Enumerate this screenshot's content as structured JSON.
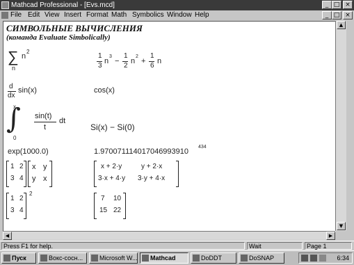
{
  "window": {
    "title": "Mathcad Professional - [Evs.mcd]"
  },
  "menu": {
    "items": [
      "File",
      "Edit",
      "View",
      "Insert",
      "Format",
      "Math",
      "Symbolics",
      "Window",
      "Help"
    ]
  },
  "document": {
    "heading1": "СИМВОЛЬНЫЕ  ВЫЧИСЛЕНИЯ",
    "heading2": "(команда Evaluate Simbolically)",
    "sum": {
      "symbol": "∑",
      "term": "n",
      "exp": "2",
      "index": "n",
      "r1": "1",
      "r1d": "3",
      "r1e": "3",
      "r2": "1",
      "r2d": "2",
      "r2e": "2",
      "r3": "1",
      "r3d": "6",
      "r3v": "n"
    },
    "deriv": {
      "num": "d",
      "den": "dx",
      "expr": "sin(x)",
      "result": "cos(x)"
    },
    "integral": {
      "sym": "∫",
      "upper": "x",
      "lower": "0",
      "num": "sin(t)",
      "den": "t",
      "dt": "dt",
      "result": "Si(x) − Si(0)"
    },
    "expo": {
      "expr": "exp(1000.0)",
      "result": "1.970071114017046993910",
      "exp": "434"
    },
    "matmul": {
      "a": [
        "1",
        "2",
        "3",
        "4"
      ],
      "b": [
        "x",
        "y",
        "y",
        "x"
      ],
      "r": [
        "x + 2·y",
        "y + 2·x",
        "3·x + 4·y",
        "3·y + 4·x"
      ]
    },
    "matsq": {
      "a": [
        "1",
        "2",
        "3",
        "4"
      ],
      "exp": "2",
      "r": [
        "7",
        "10",
        "15",
        "22"
      ]
    }
  },
  "status": {
    "help": "Press F1 for help.",
    "mode": "Wait",
    "page": "Page 1"
  },
  "taskbar": {
    "start": "Пуск",
    "buttons": [
      "Вокс-сосн...",
      "Microsoft W...",
      "Mathcad",
      "DoDDT",
      "DoSNAP"
    ],
    "clock": "6:34"
  },
  "colors": {
    "titlebar": "#3a3a3a",
    "chrome": "#c6c6c6",
    "document": "#ffffff"
  }
}
